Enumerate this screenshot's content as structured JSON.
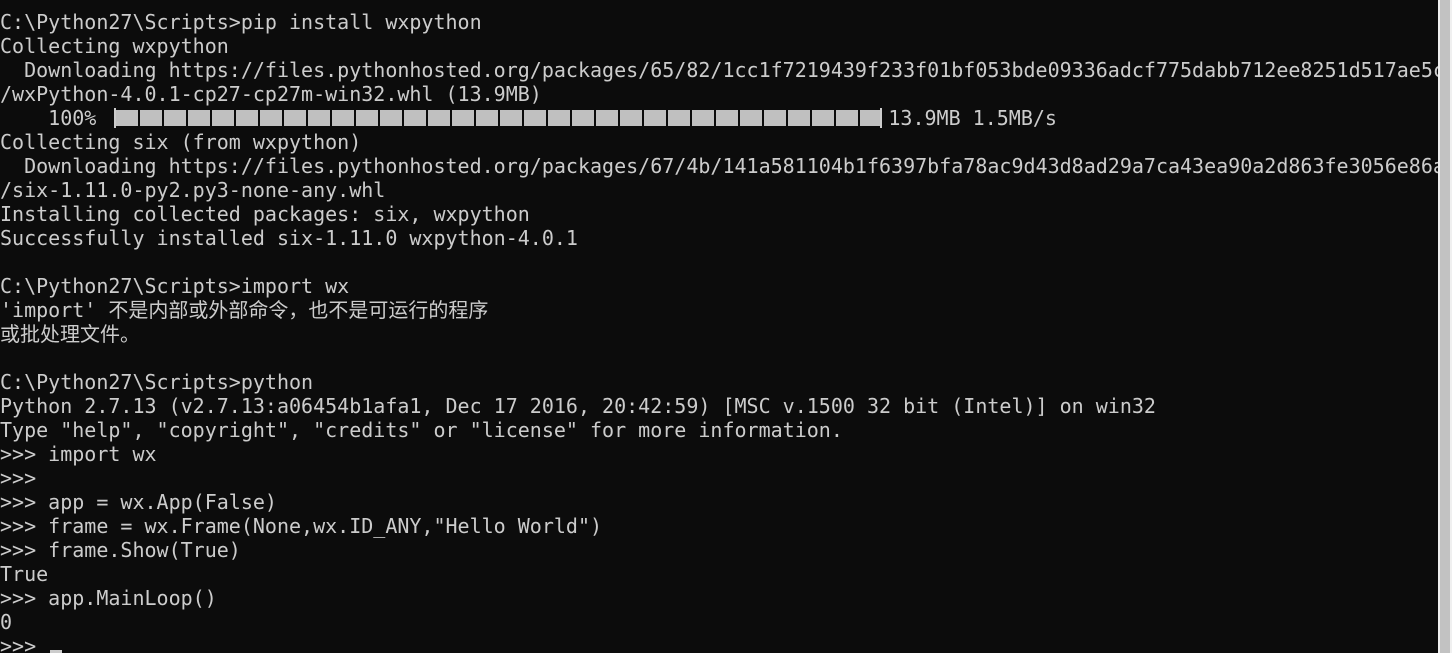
{
  "console": {
    "background": "#0c0c0c",
    "foreground": "#cccccc",
    "lines": [
      "C:\\Python27\\Scripts>pip install wxpython",
      "Collecting wxpython",
      "  Downloading https://files.pythonhosted.org/packages/65/82/1cc1f7219439f233f01bf053bde09336adcf775dabb712ee8251d517ae5c",
      "/wxPython-4.0.1-cp27-cp27m-win32.whl (13.9MB)"
    ],
    "progress": {
      "percent_label": "    100% ",
      "fraction": 1.0,
      "size_label": "13.9MB 1.5MB/s"
    },
    "lines_after": [
      "Collecting six (from wxpython)",
      "  Downloading https://files.pythonhosted.org/packages/67/4b/141a581104b1f6397bfa78ac9d43d8ad29a7ca43ea90a2d863fe3056e86a",
      "/six-1.11.0-py2.py3-none-any.whl",
      "Installing collected packages: six, wxpython",
      "Successfully installed six-1.11.0 wxpython-4.0.1",
      "",
      "C:\\Python27\\Scripts>import wx",
      "'import' 不是内部或外部命令，也不是可运行的程序",
      "或批处理文件。",
      "",
      "C:\\Python27\\Scripts>python",
      "Python 2.7.13 (v2.7.13:a06454b1afa1, Dec 17 2016, 20:42:59) [MSC v.1500 32 bit (Intel)] on win32",
      "Type \"help\", \"copyright\", \"credits\" or \"license\" for more information.",
      ">>> import wx",
      ">>>",
      ">>> app = wx.App(False)",
      ">>> frame = wx.Frame(None,wx.ID_ANY,\"Hello World\")",
      ">>> frame.Show(True)",
      "True",
      ">>> app.MainLoop()",
      "0"
    ],
    "prompt": ">>> "
  }
}
